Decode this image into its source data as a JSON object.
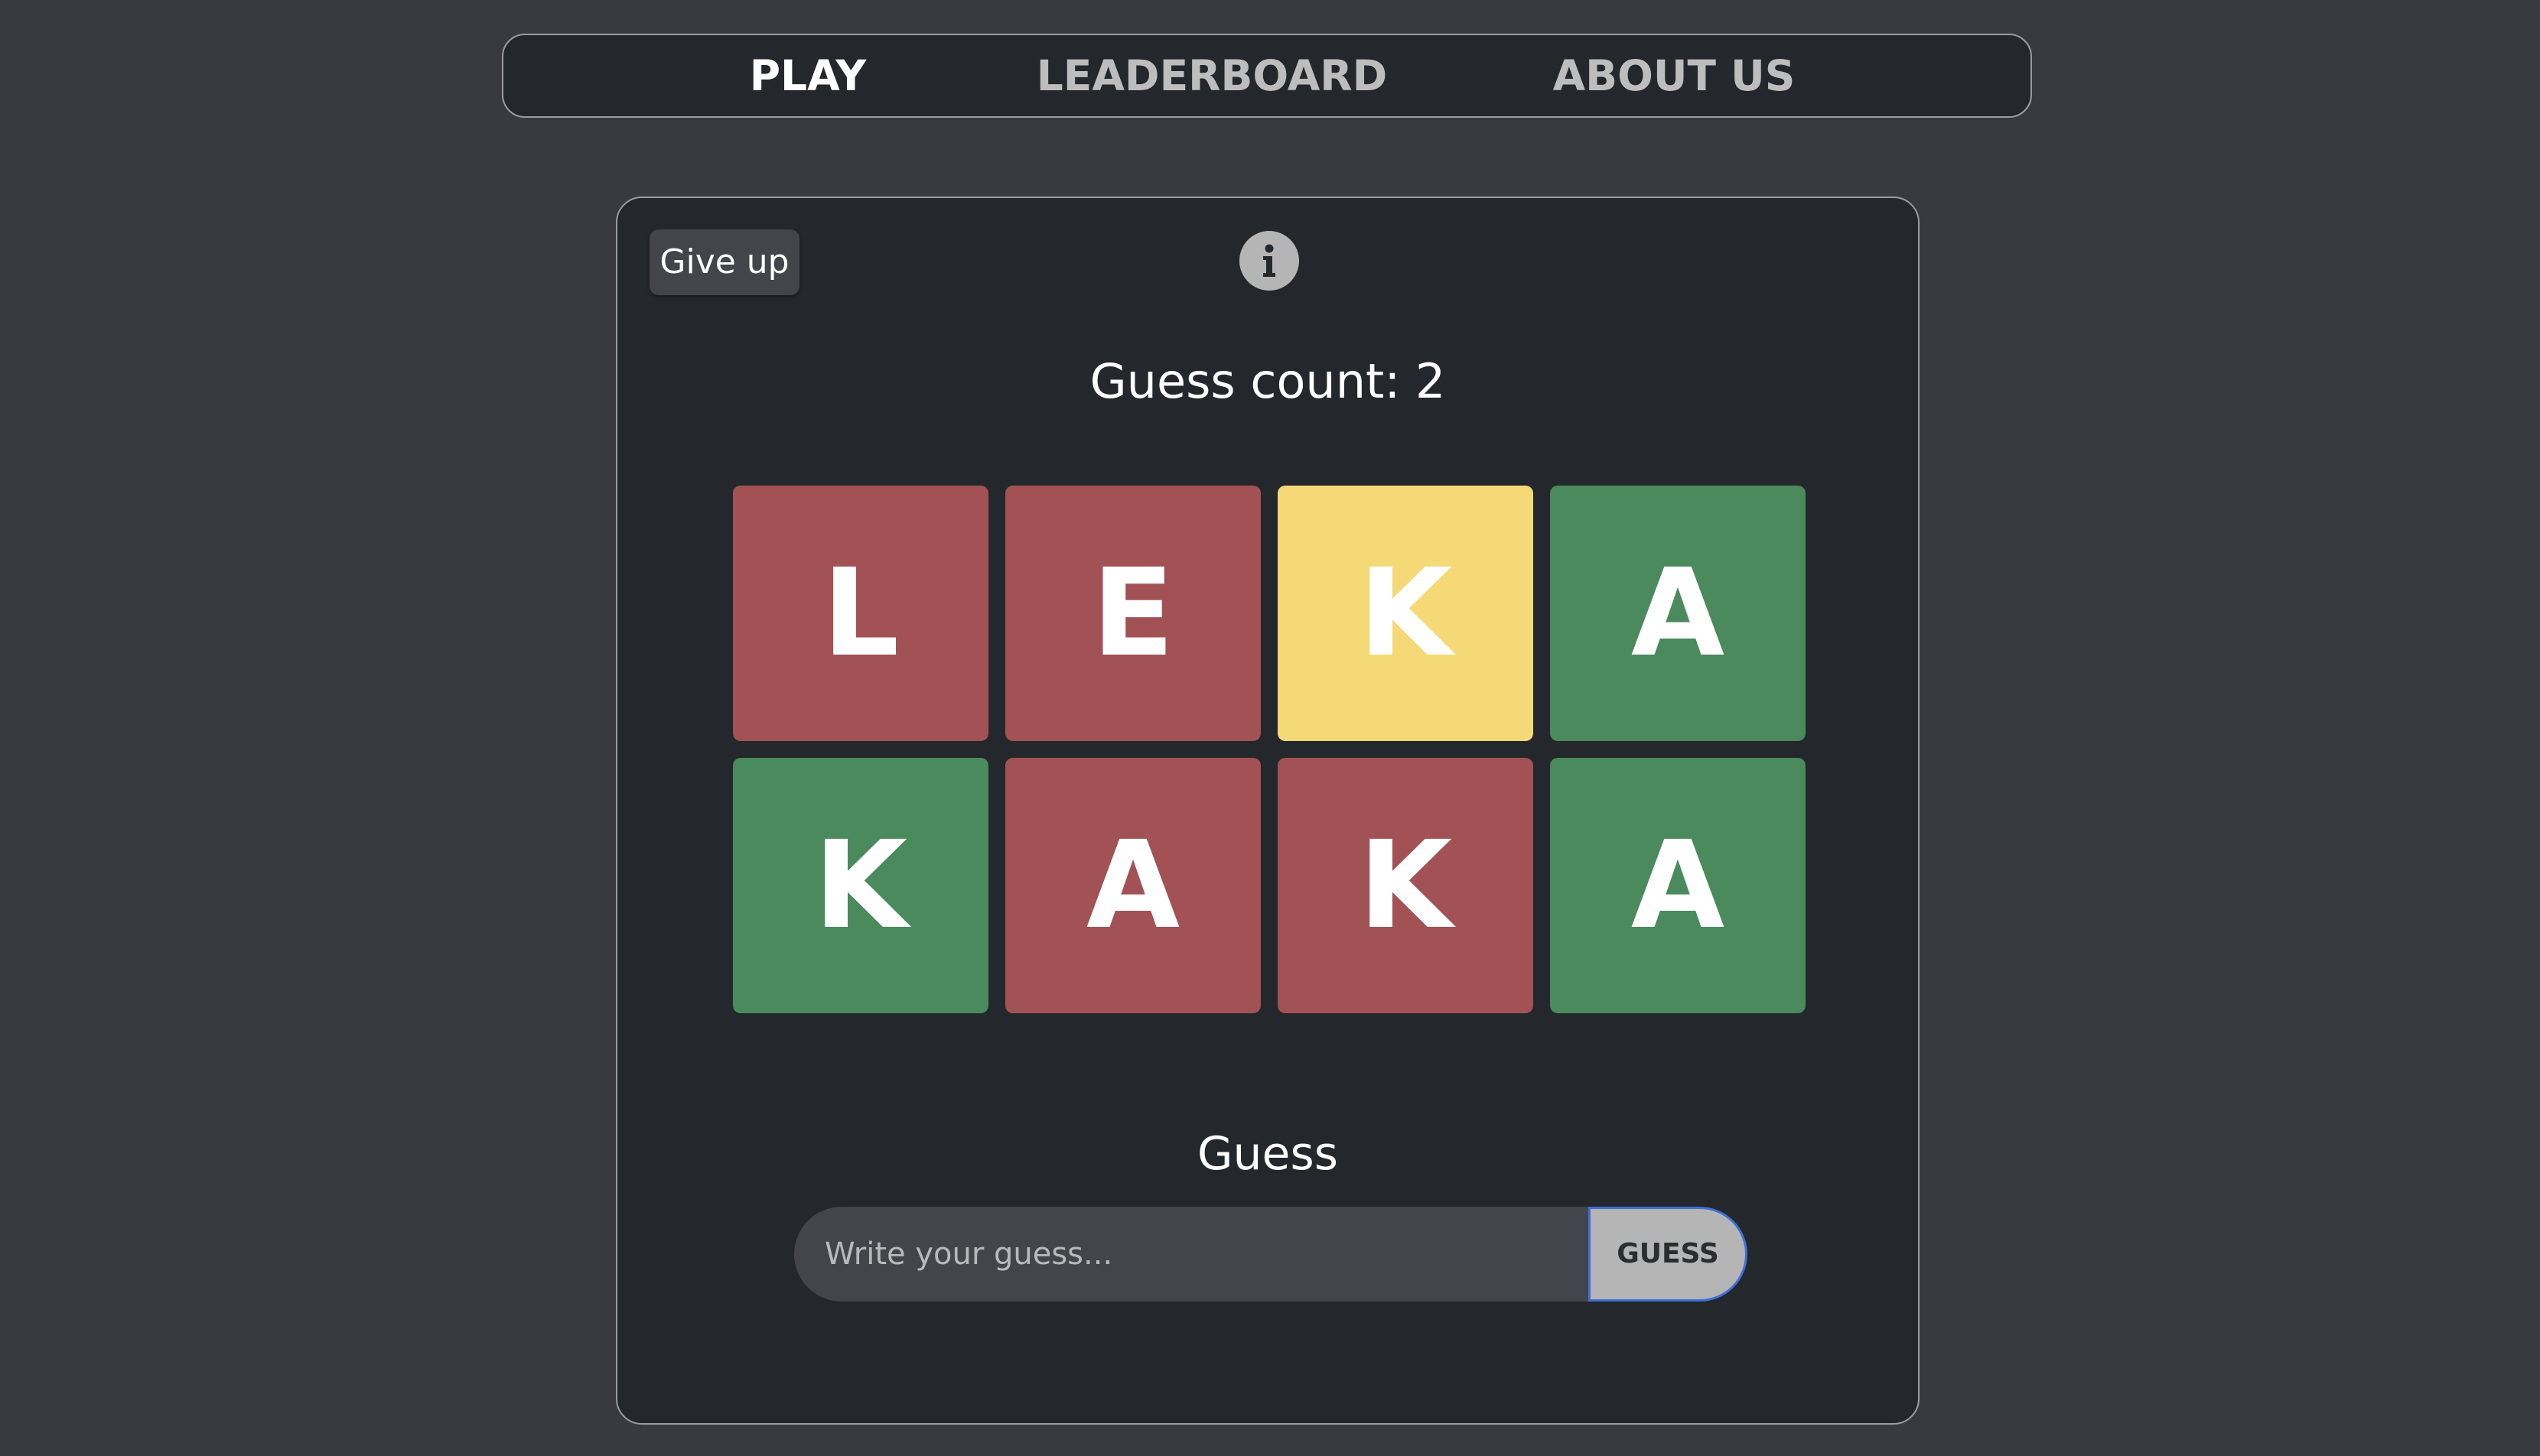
{
  "nav": {
    "items": [
      {
        "label": "PLAY",
        "active": true
      },
      {
        "label": "LEADERBOARD",
        "active": false
      },
      {
        "label": "ABOUT US",
        "active": false
      }
    ]
  },
  "game": {
    "give_up_label": "Give up",
    "info_icon": "info-icon",
    "guess_count_label": "Guess count: 2",
    "guess_count": 2,
    "colors": {
      "wrong": "#a25255",
      "present": "#f6d977",
      "correct": "#4a8a5c"
    },
    "rows": [
      [
        {
          "letter": "L",
          "state": "wrong"
        },
        {
          "letter": "E",
          "state": "wrong"
        },
        {
          "letter": "K",
          "state": "present"
        },
        {
          "letter": "A",
          "state": "correct"
        }
      ],
      [
        {
          "letter": "K",
          "state": "correct"
        },
        {
          "letter": "A",
          "state": "wrong"
        },
        {
          "letter": "K",
          "state": "wrong"
        },
        {
          "letter": "A",
          "state": "correct"
        }
      ]
    ],
    "guess_section": {
      "label": "Guess",
      "input_value": "",
      "input_placeholder": "Write your guess...",
      "button_label": "GUESS"
    }
  }
}
